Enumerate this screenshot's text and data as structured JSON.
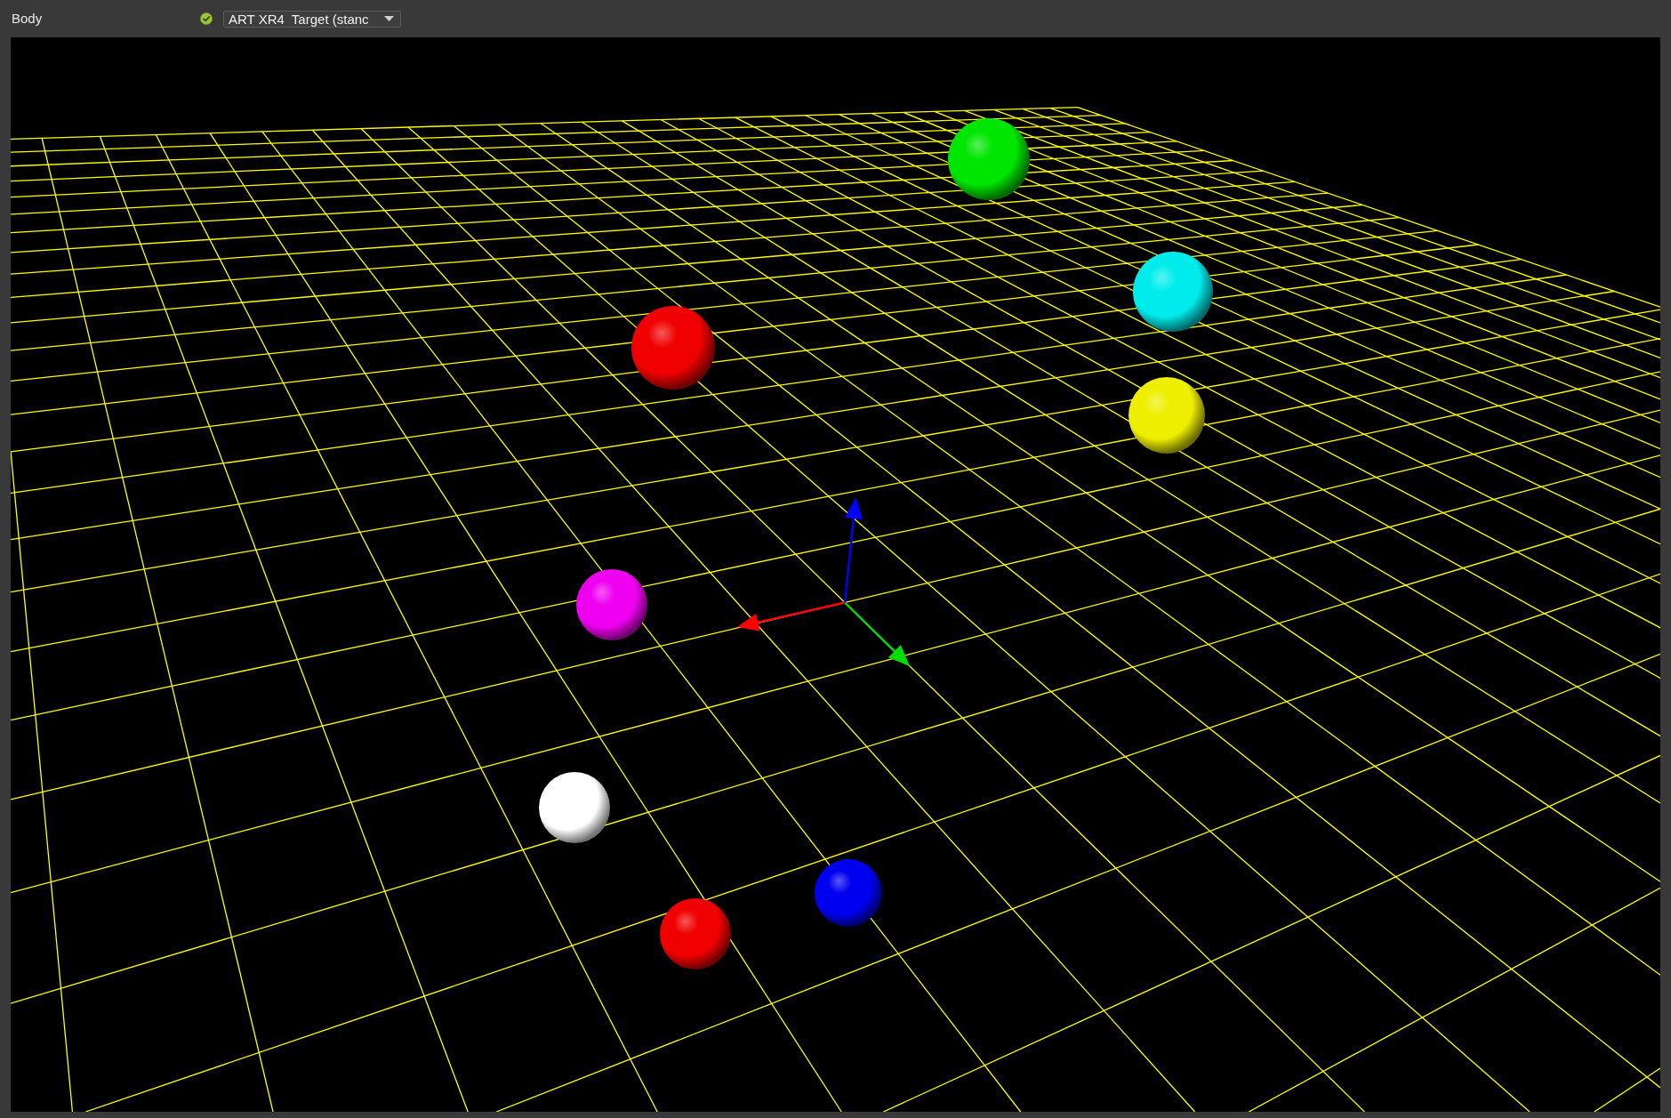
{
  "header": {
    "label": "Body",
    "selector": {
      "value": "ART XR4  Target (stanc"
    }
  },
  "viewport": {
    "markers": [
      {
        "color": "#00e600"
      },
      {
        "color": "#00ecec"
      },
      {
        "color": "#f00000"
      },
      {
        "color": "#eeee00"
      },
      {
        "color": "#f000f0"
      },
      {
        "color": "#ffffff"
      },
      {
        "color": "#0000f0"
      },
      {
        "color": "#f00000"
      }
    ]
  }
}
